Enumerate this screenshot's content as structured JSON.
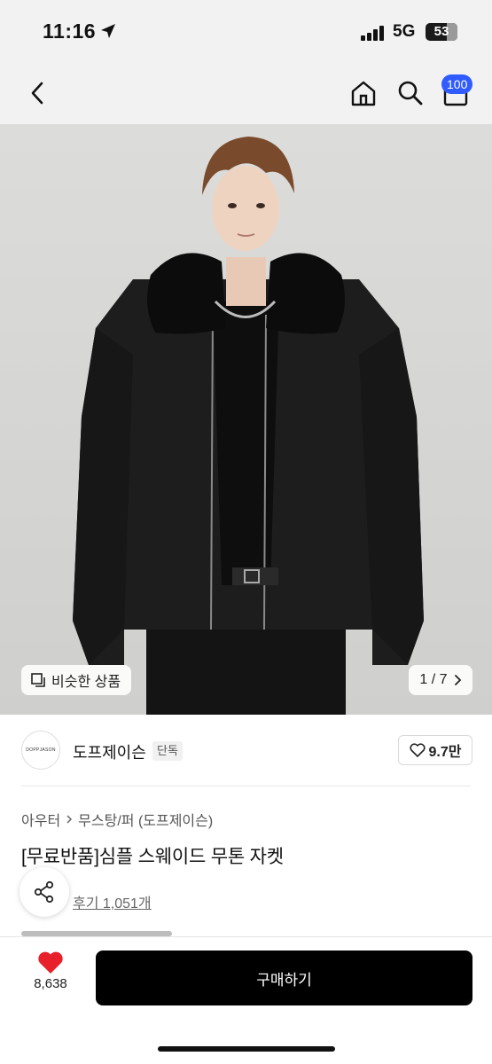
{
  "status_bar": {
    "time": "11:16",
    "network": "5G",
    "battery": "53"
  },
  "header": {
    "cart_badge": "100"
  },
  "gallery": {
    "similar_label": "비슷한 상품",
    "pager": "1 / 7"
  },
  "brand": {
    "logo_text": "DOPPJASON",
    "name": "도프제이슨",
    "tag": "단독",
    "likes": "9.7만"
  },
  "breadcrumb": [
    "아우터",
    "무스탕/퍼 (도프제이슨)"
  ],
  "product": {
    "title": "[무료반품]심플 스웨이드 무톤 자켓",
    "reviews": "후기 1,051개"
  },
  "bottom": {
    "wish_count": "8,638",
    "buy_label": "구매하기"
  },
  "colors": {
    "accent_badge": "#2f5bff",
    "wish_heart": "#e8202a",
    "buy_button": "#000000"
  },
  "icons": [
    "location-arrow-icon",
    "signal-icon",
    "battery-icon",
    "back-icon",
    "home-icon",
    "search-icon",
    "cart-icon",
    "similar-icon",
    "chevron-right-icon",
    "heart-outline-icon",
    "share-icon",
    "heart-filled-icon"
  ]
}
